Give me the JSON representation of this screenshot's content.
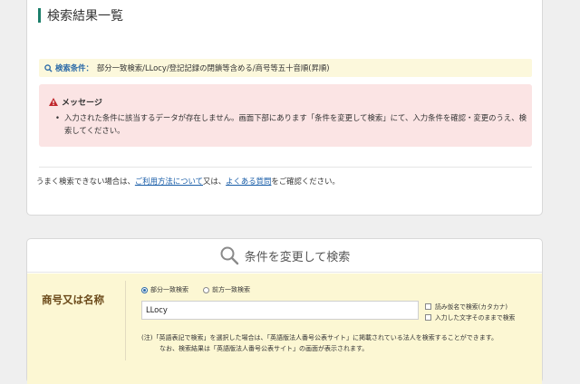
{
  "results": {
    "title": "検索結果一覧",
    "condition_label": "検索条件：",
    "condition_text": "部分一致検索/LLocy/登記記録の閉鎖等含める/商号等五十音順(昇順)",
    "message": {
      "title": "メッセージ",
      "body": "入力された条件に該当するデータが存在しません。画面下部にあります「条件を変更して検索」にて、入力条件を確認・変更のうえ、検索してください。"
    },
    "help": {
      "prefix": "うまく検索できない場合は、",
      "link1": "ご利用方法について",
      "middle": "又は、",
      "link2": "よくある質問",
      "suffix": "をご確認ください。"
    }
  },
  "search": {
    "heading": "条件を変更して検索",
    "field_label": "商号又は名称",
    "radio_partial": "部分一致検索",
    "radio_prefix": "前方一致検索",
    "selected": "partial",
    "input_value": "LLocy",
    "check_kana": "読み仮名で検索(カタカナ)",
    "check_exact": "入力した文字そのままで検索",
    "note_line1": "(注)「英語表記で検索」を選択した場合は、「英語版法人番号公表サイト」に掲載されている法人を検索することができます。",
    "note_line2": "なお、検索結果は「英語版法人番号公表サイト」の画面が表示されます。"
  },
  "colors": {
    "accent": "#1c7f6b",
    "link": "#1a5ea8",
    "label_brown": "#6b4a1a",
    "warning_red": "#c0282d"
  },
  "icons": {
    "condition": "search-icon",
    "message": "warning-icon",
    "search_heading": "magnifier-icon"
  }
}
